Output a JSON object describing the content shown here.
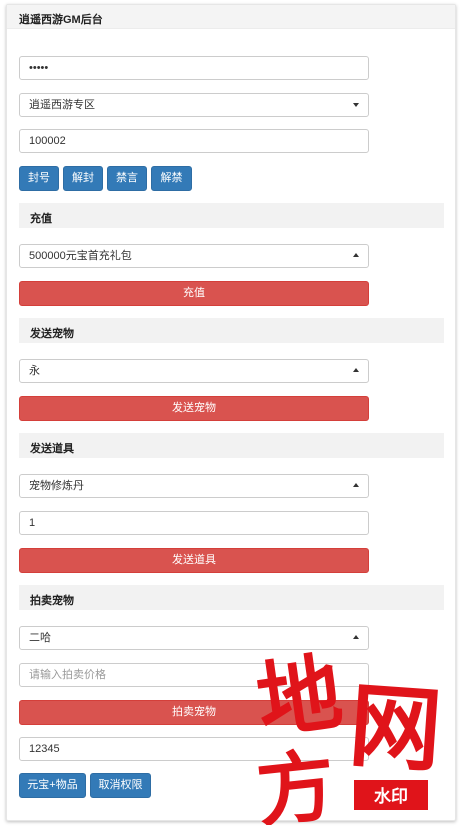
{
  "header": {
    "title": "逍遥西游GM后台"
  },
  "account": {
    "password_value": "•••••",
    "server_value": "逍遥西游专区",
    "role_id_value": "100002"
  },
  "account_actions": {
    "ban_label": "封号",
    "unban_label": "解封",
    "mute_label": "禁言",
    "unmute_label": "解禁"
  },
  "recharge": {
    "heading": "充值",
    "package_value": "500000元宝首充礼包",
    "button_label": "充值"
  },
  "send_pet": {
    "heading": "发送宠物",
    "pet_value": "永",
    "button_label": "发送宠物"
  },
  "send_item": {
    "heading": "发送道具",
    "item_value": "宠物修炼丹",
    "quantity_value": "1",
    "button_label": "发送道具"
  },
  "auction_pet": {
    "heading": "拍卖宠物",
    "pet_value": "二哈",
    "price_placeholder": "请输入拍卖价格",
    "button_label": "拍卖宠物"
  },
  "permissions": {
    "code_value": "12345",
    "grant_label": "元宝+物品",
    "revoke_label": "取消权限"
  },
  "watermark": {
    "glyphs": [
      "地",
      "网",
      "方"
    ],
    "stamp_text": "水印"
  },
  "colors": {
    "primary": "#337ab7",
    "danger": "#d9534f",
    "watermark_red": "#e0141a"
  }
}
